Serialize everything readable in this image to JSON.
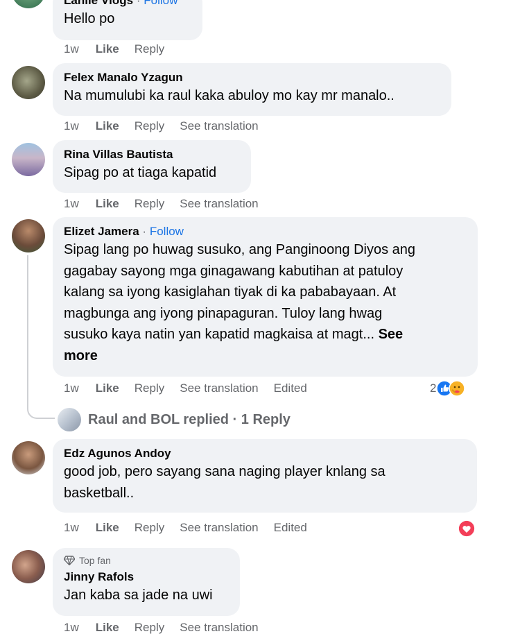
{
  "comments": [
    {
      "author": "Lanlie Vlogs",
      "follow": "Follow",
      "text": "Hello po",
      "time": "1w",
      "like": "Like",
      "reply": "Reply"
    },
    {
      "author": "Felex Manalo Yzagun",
      "text": "Na mumulubi ka raul kaka abuloy mo kay mr manalo..",
      "time": "1w",
      "like": "Like",
      "reply": "Reply",
      "translate": "See translation"
    },
    {
      "author": "Rina Villas Bautista",
      "text": "Sipag po at tiaga kapatid",
      "time": "1w",
      "like": "Like",
      "reply": "Reply",
      "translate": "See translation"
    },
    {
      "author": "Elizet Jamera",
      "follow": "Follow",
      "lines": [
        "Sipag lang po huwag susuko, ang Panginoong Diyos ang",
        "gagabay sayong mga ginagawang kabutihan at patuloy",
        "kalang sa iyong kasiglahan tiyak di ka pababayaan. At",
        "magbunga ang iyong pinapaguran. Tuloy lang hwag",
        "susuko kaya natin yan kapatid magkaisa at magt... "
      ],
      "see_more_1": "See",
      "see_more_2": "more",
      "time": "1w",
      "like": "Like",
      "reply": "Reply",
      "translate": "See translation",
      "edited": "Edited",
      "reaction_count": "2",
      "replied_text": "Raul and BOL replied · 1 Reply"
    },
    {
      "author": "Edz Agunos Andoy",
      "lines": [
        "good job, pero sayang sana naging player knlang sa",
        "basketball.."
      ],
      "time": "1w",
      "like": "Like",
      "reply": "Reply",
      "translate": "See translation",
      "edited": "Edited"
    },
    {
      "badge": "Top fan",
      "author": "Jinny Rafols",
      "text": "Jan kaba sa jade na uwi",
      "time": "1w",
      "like": "Like",
      "reply": "Reply",
      "translate": "See translation"
    }
  ],
  "colors": {
    "bubble": "#f0f2f5",
    "link": "#1b74e4",
    "muted": "#65676b",
    "like_reaction": "#1877f2",
    "love_reaction": "#f33e58",
    "care_reaction": "#f7b125"
  }
}
